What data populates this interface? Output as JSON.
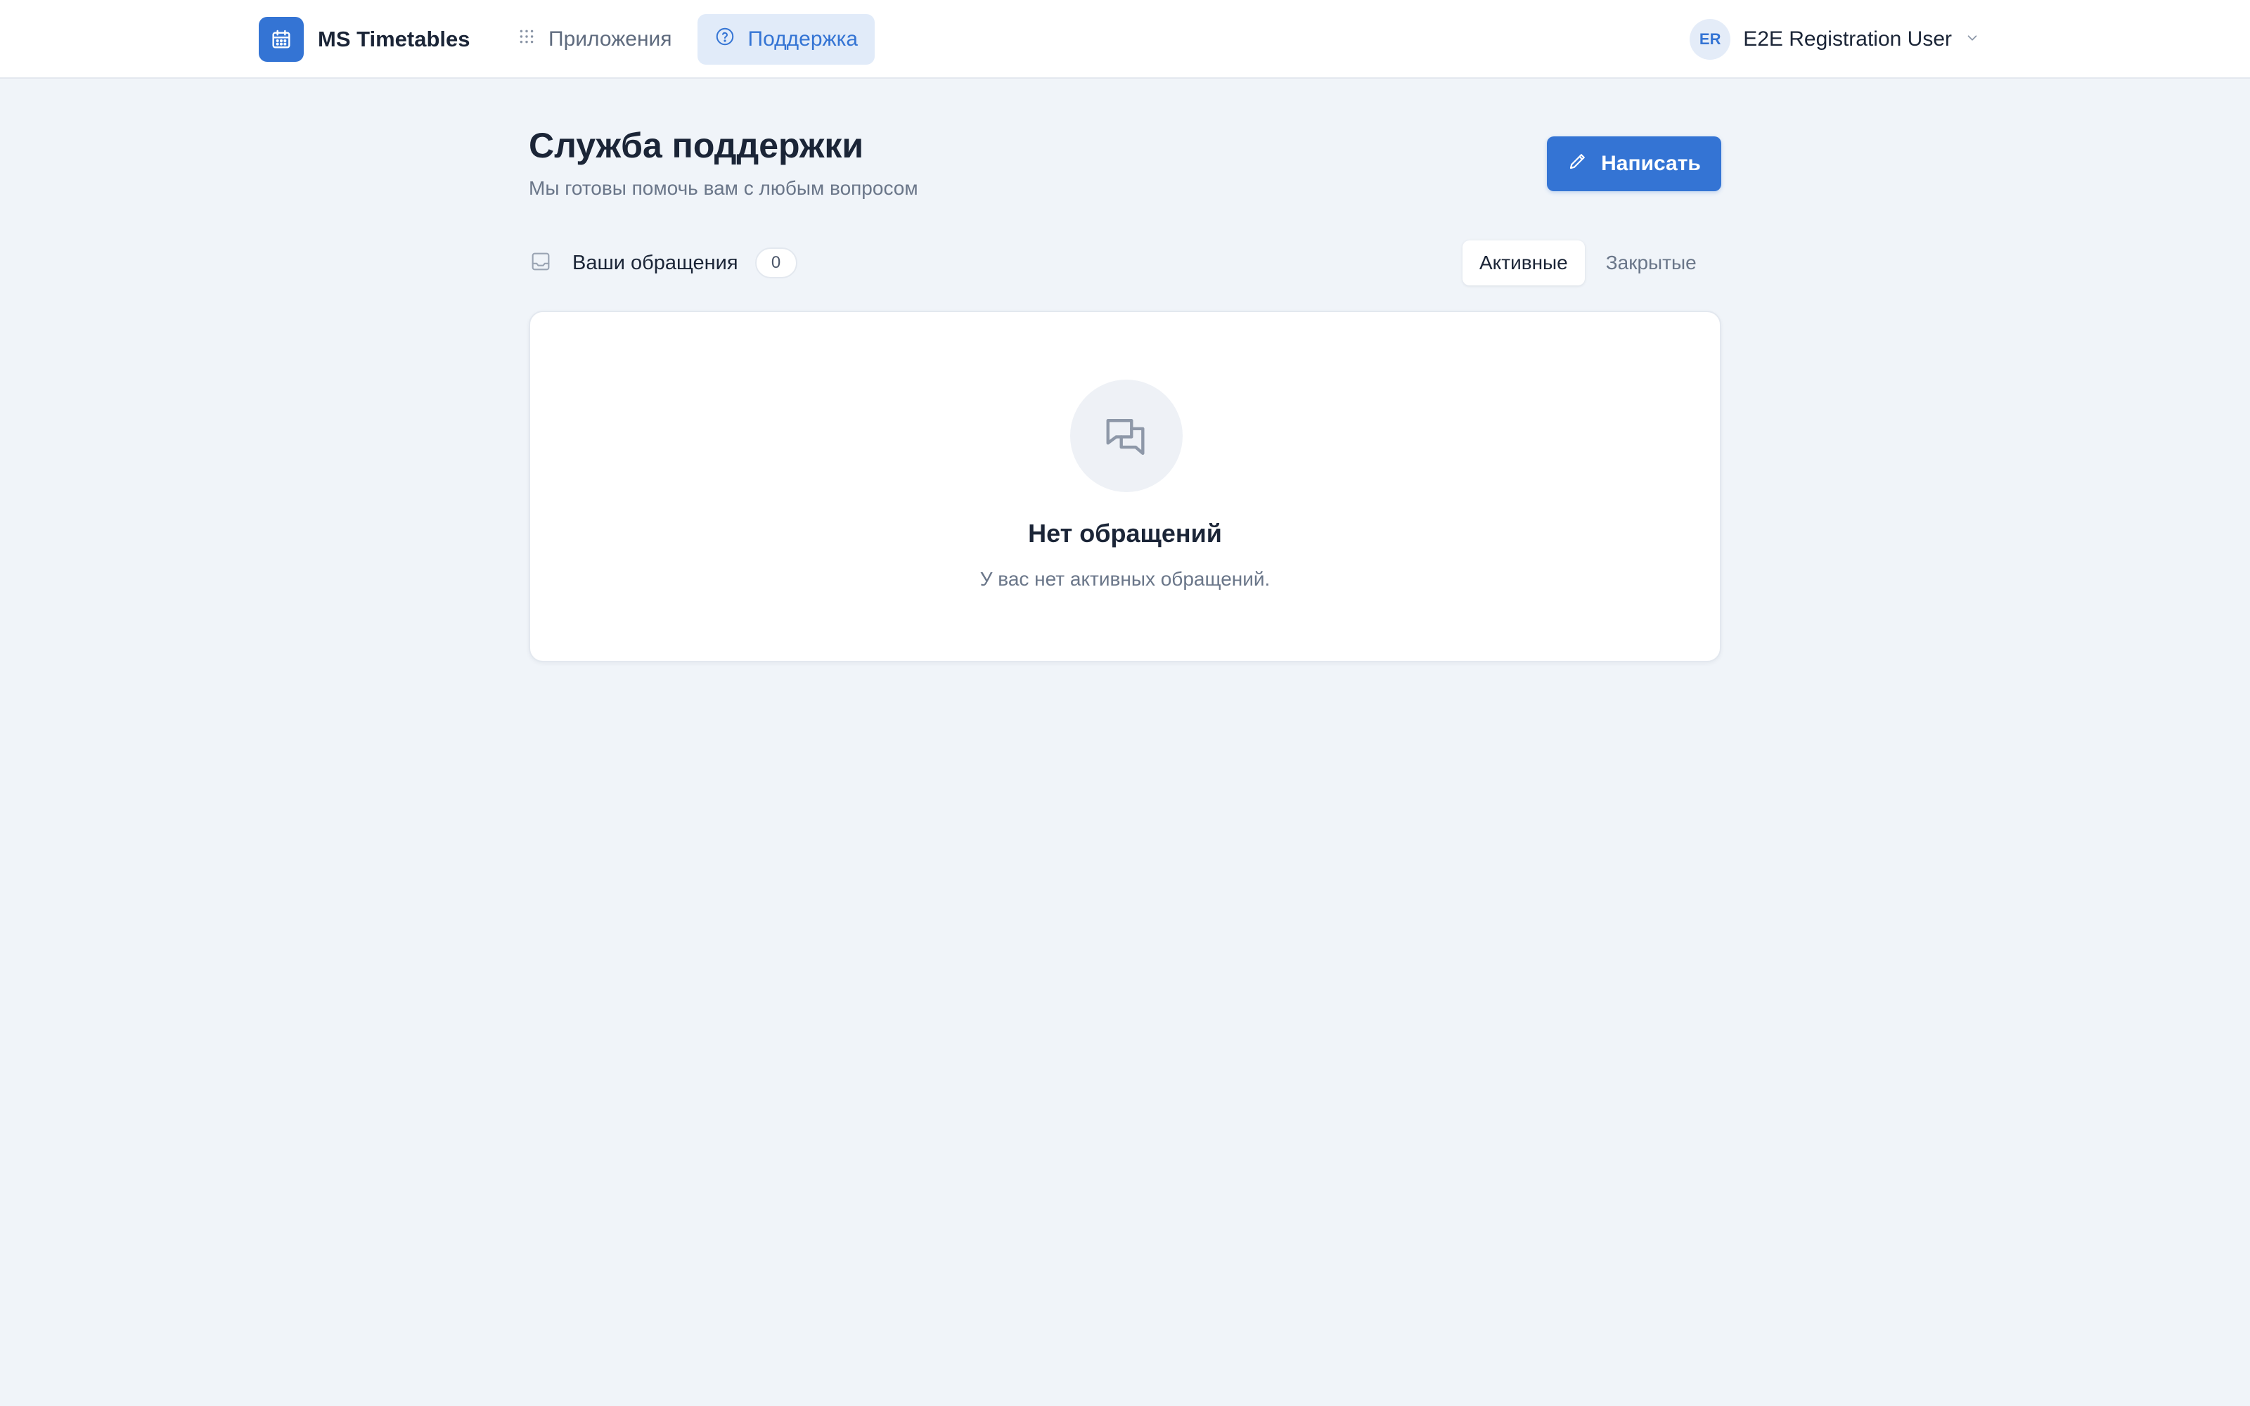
{
  "brand": {
    "name": "MS Timetables",
    "icon": "calendar-icon"
  },
  "nav": [
    {
      "label": "Приложения",
      "icon": "apps-grid-icon",
      "active": false
    },
    {
      "label": "Поддержка",
      "icon": "help-circle-icon",
      "active": true
    }
  ],
  "user": {
    "initials": "ER",
    "name": "E2E Registration User"
  },
  "page": {
    "title": "Служба поддержки",
    "subtitle": "Мы готовы помочь вам с любым вопросом",
    "write_button": "Написать"
  },
  "tickets": {
    "label": "Ваши обращения",
    "count": "0",
    "tabs": [
      {
        "label": "Активные",
        "active": true
      },
      {
        "label": "Закрытые",
        "active": false
      }
    ]
  },
  "empty_state": {
    "title": "Нет обращений",
    "text": "У вас нет активных обращений."
  },
  "colors": {
    "accent": "#3474d4",
    "background": "#f0f4f9",
    "text": "#1b2537",
    "muted": "#6a7689"
  }
}
